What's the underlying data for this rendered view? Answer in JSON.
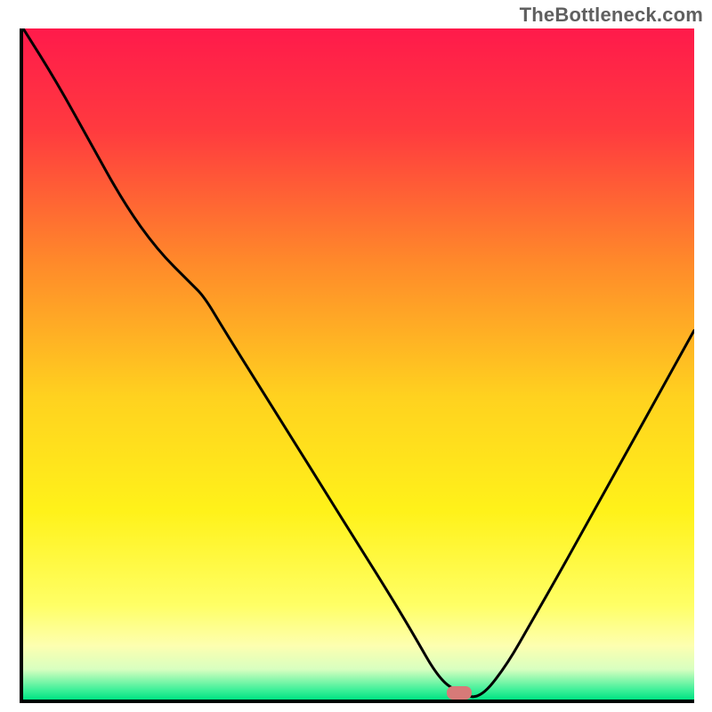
{
  "watermark": "TheBottleneck.com",
  "chart_data": {
    "type": "line",
    "title": "",
    "xlabel": "",
    "ylabel": "",
    "xlim": [
      0,
      100
    ],
    "ylim": [
      0,
      100
    ],
    "x": [
      0,
      5,
      10,
      15,
      20,
      25,
      27,
      30,
      35,
      40,
      45,
      50,
      55,
      58,
      62,
      65,
      68,
      72,
      76,
      80,
      85,
      90,
      95,
      100
    ],
    "y": [
      100,
      92,
      83,
      74,
      67,
      62,
      60,
      55,
      47,
      39,
      31,
      23,
      15,
      10,
      3,
      1,
      0,
      5,
      12,
      19,
      28,
      37,
      46,
      55
    ],
    "optimum_x": 65,
    "gradient_stops": [
      {
        "pos": 0.0,
        "color": "#ff1a4b"
      },
      {
        "pos": 0.15,
        "color": "#ff3a3f"
      },
      {
        "pos": 0.35,
        "color": "#ff8a2a"
      },
      {
        "pos": 0.55,
        "color": "#ffd21f"
      },
      {
        "pos": 0.72,
        "color": "#fff21a"
      },
      {
        "pos": 0.86,
        "color": "#ffff66"
      },
      {
        "pos": 0.92,
        "color": "#fdffb0"
      },
      {
        "pos": 0.955,
        "color": "#d8ffc0"
      },
      {
        "pos": 0.985,
        "color": "#41f09a"
      },
      {
        "pos": 1.0,
        "color": "#00e383"
      }
    ]
  }
}
